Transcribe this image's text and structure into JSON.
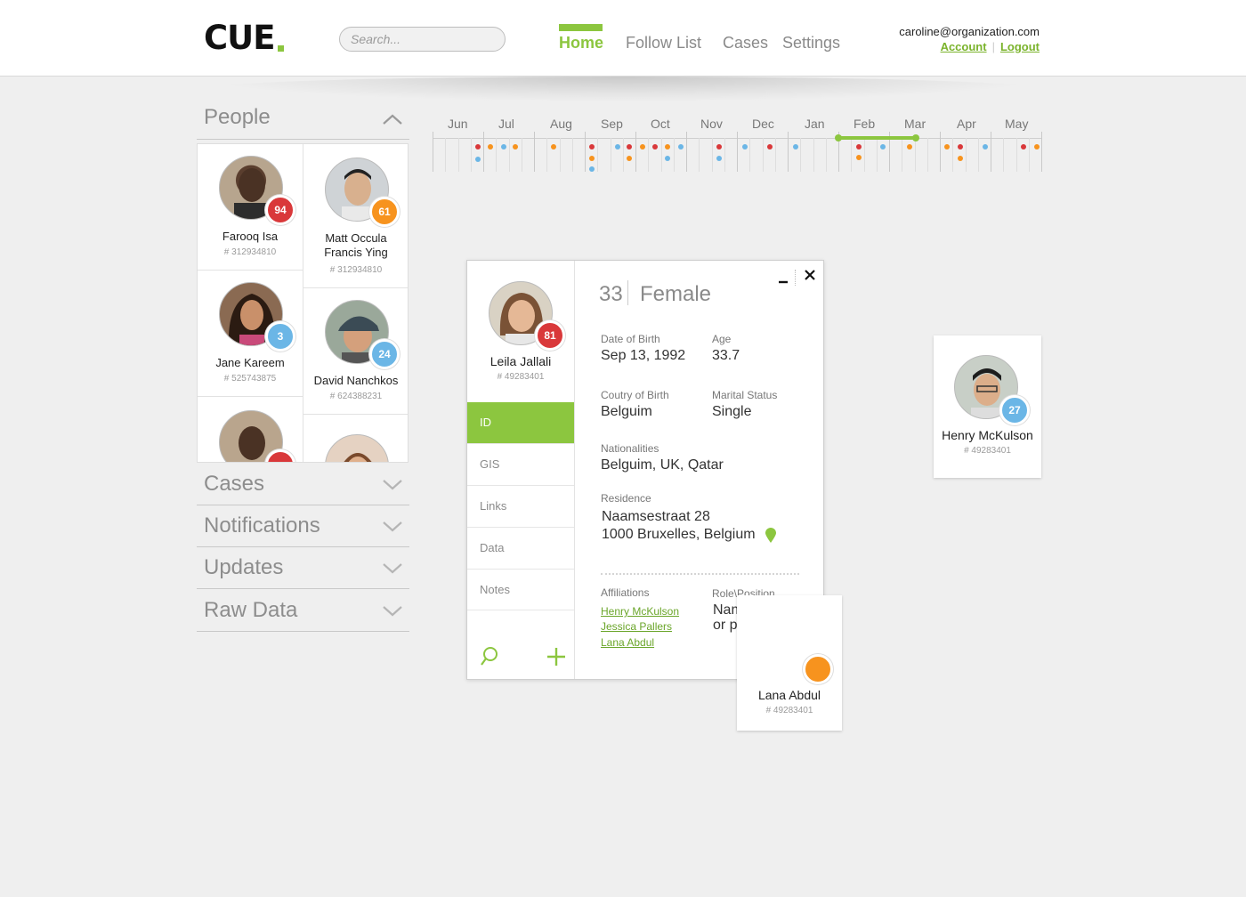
{
  "header": {
    "logo": "CUE",
    "search_placeholder": "Search...",
    "nav": [
      {
        "label": "Home",
        "active": true
      },
      {
        "label": "Follow List",
        "active": false
      },
      {
        "label": "Cases",
        "active": false
      },
      {
        "label": "Settings",
        "active": false
      }
    ],
    "user": {
      "email": "caroline@organization.com",
      "account": "Account",
      "separator": "|",
      "logout": "Logout"
    }
  },
  "sidebar": {
    "people_title": "People",
    "people": [
      {
        "name": "Farooq Isa",
        "id": "# 312934810",
        "score": "94",
        "color": "red"
      },
      {
        "name": "Matt Occula Francis Ying",
        "name1": "Matt Occula",
        "name2": "Francis Ying",
        "id": "# 312934810",
        "score": "61",
        "color": "orange"
      },
      {
        "name": "Jane Kareem",
        "id": "# 525743875",
        "score": "3",
        "color": "blue"
      },
      {
        "name": "David Nanchkos",
        "id": "# 624388231",
        "score": "24",
        "color": "blue"
      }
    ],
    "sections": [
      "Cases",
      "Notifications",
      "Updates",
      "Raw Data"
    ]
  },
  "timeline": {
    "months": [
      "Jun",
      "Jul",
      "Aug",
      "Sep",
      "Oct",
      "Nov",
      "Dec",
      "Jan",
      "Feb",
      "Mar",
      "Apr",
      "May"
    ]
  },
  "detail": {
    "name": "Leila Jallali",
    "id": "# 49283401",
    "score": "81",
    "age_header": "33",
    "gender": "Female",
    "tabs": [
      "ID",
      "GIS",
      "Links",
      "Data",
      "Notes"
    ],
    "active_tab": "ID",
    "fields": {
      "dob_label": "Date of Birth",
      "dob": "Sep 13, 1992",
      "age_label": "Age",
      "age": "33.7",
      "country_label": "Coutry of Birth",
      "country": "Belguim",
      "marital_label": "Marital Status",
      "marital": "Single",
      "nationalities_label": "Nationalities",
      "nationalities": "Belguim, UK, Qatar",
      "residence_label": "Residence",
      "residence_line1": "Naamsestraat 28",
      "residence_line2": "1000 Bruxelles, Belgium",
      "affiliations_label": "Affiliations",
      "affiliations": [
        "Henry McKulson",
        "Jessica Pallers",
        "Lana Abdul"
      ],
      "role_label": "Role\\Position",
      "role_line1": "Name of Role",
      "role_line2": "or position"
    }
  },
  "floating_cards": [
    {
      "name": "Henry McKulson",
      "id": "# 49283401",
      "score": "27",
      "color": "blue"
    },
    {
      "name": "Lana Abdul",
      "id": "# 49283401",
      "color": "orange"
    }
  ],
  "colors": {
    "accent": "#8cc63f",
    "red": "#d9383a",
    "orange": "#f7931e",
    "blue": "#6bb6e6"
  }
}
